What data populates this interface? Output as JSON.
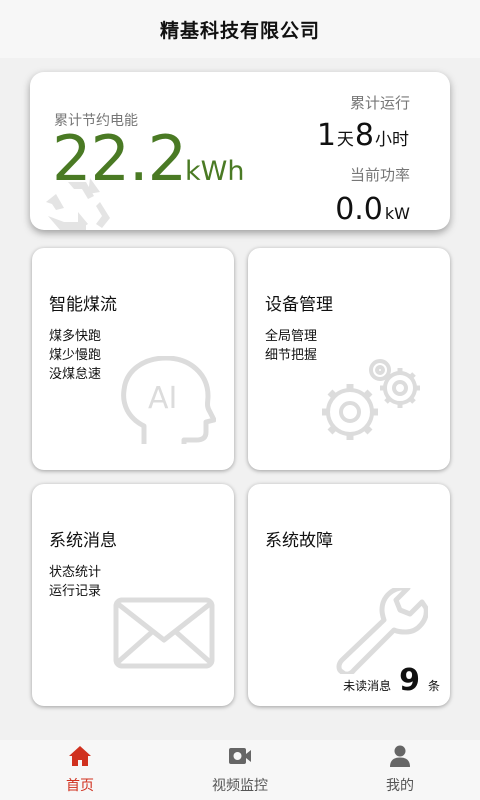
{
  "header": {
    "title": "精基科技有限公司"
  },
  "energy": {
    "label": "累计节约电能",
    "value": "22.2",
    "unit": "kWh",
    "runtime_label": "累计运行",
    "runtime_days": "1",
    "runtime_days_unit": "天",
    "runtime_hours": "8",
    "runtime_hours_unit": "小时",
    "power_label": "当前功率",
    "power_value": "0.0",
    "power_unit": "kW"
  },
  "tiles": [
    {
      "title": "智能煤流",
      "lines": [
        "煤多快跑",
        "煤少慢跑",
        "没煤怠速"
      ],
      "icon": "ai-head-icon"
    },
    {
      "title": "设备管理",
      "lines": [
        "全局管理",
        "细节把握"
      ],
      "icon": "gears-icon"
    },
    {
      "title": "系统消息",
      "lines": [
        "状态统计",
        "运行记录"
      ],
      "icon": "envelope-icon"
    },
    {
      "title": "系统故障",
      "lines": [],
      "icon": "wrench-icon"
    }
  ],
  "unread": {
    "label": "未读消息",
    "count": "9",
    "unit": "条"
  },
  "tabbar": {
    "items": [
      {
        "label": "首页",
        "icon": "home-icon",
        "active": true
      },
      {
        "label": "视频监控",
        "icon": "camera-icon",
        "active": false
      },
      {
        "label": "我的",
        "icon": "user-icon",
        "active": false
      }
    ]
  },
  "colors": {
    "accent_green": "#4a7a24",
    "active_tab": "#d0311f",
    "icon_gray": "#dcdcdc"
  }
}
